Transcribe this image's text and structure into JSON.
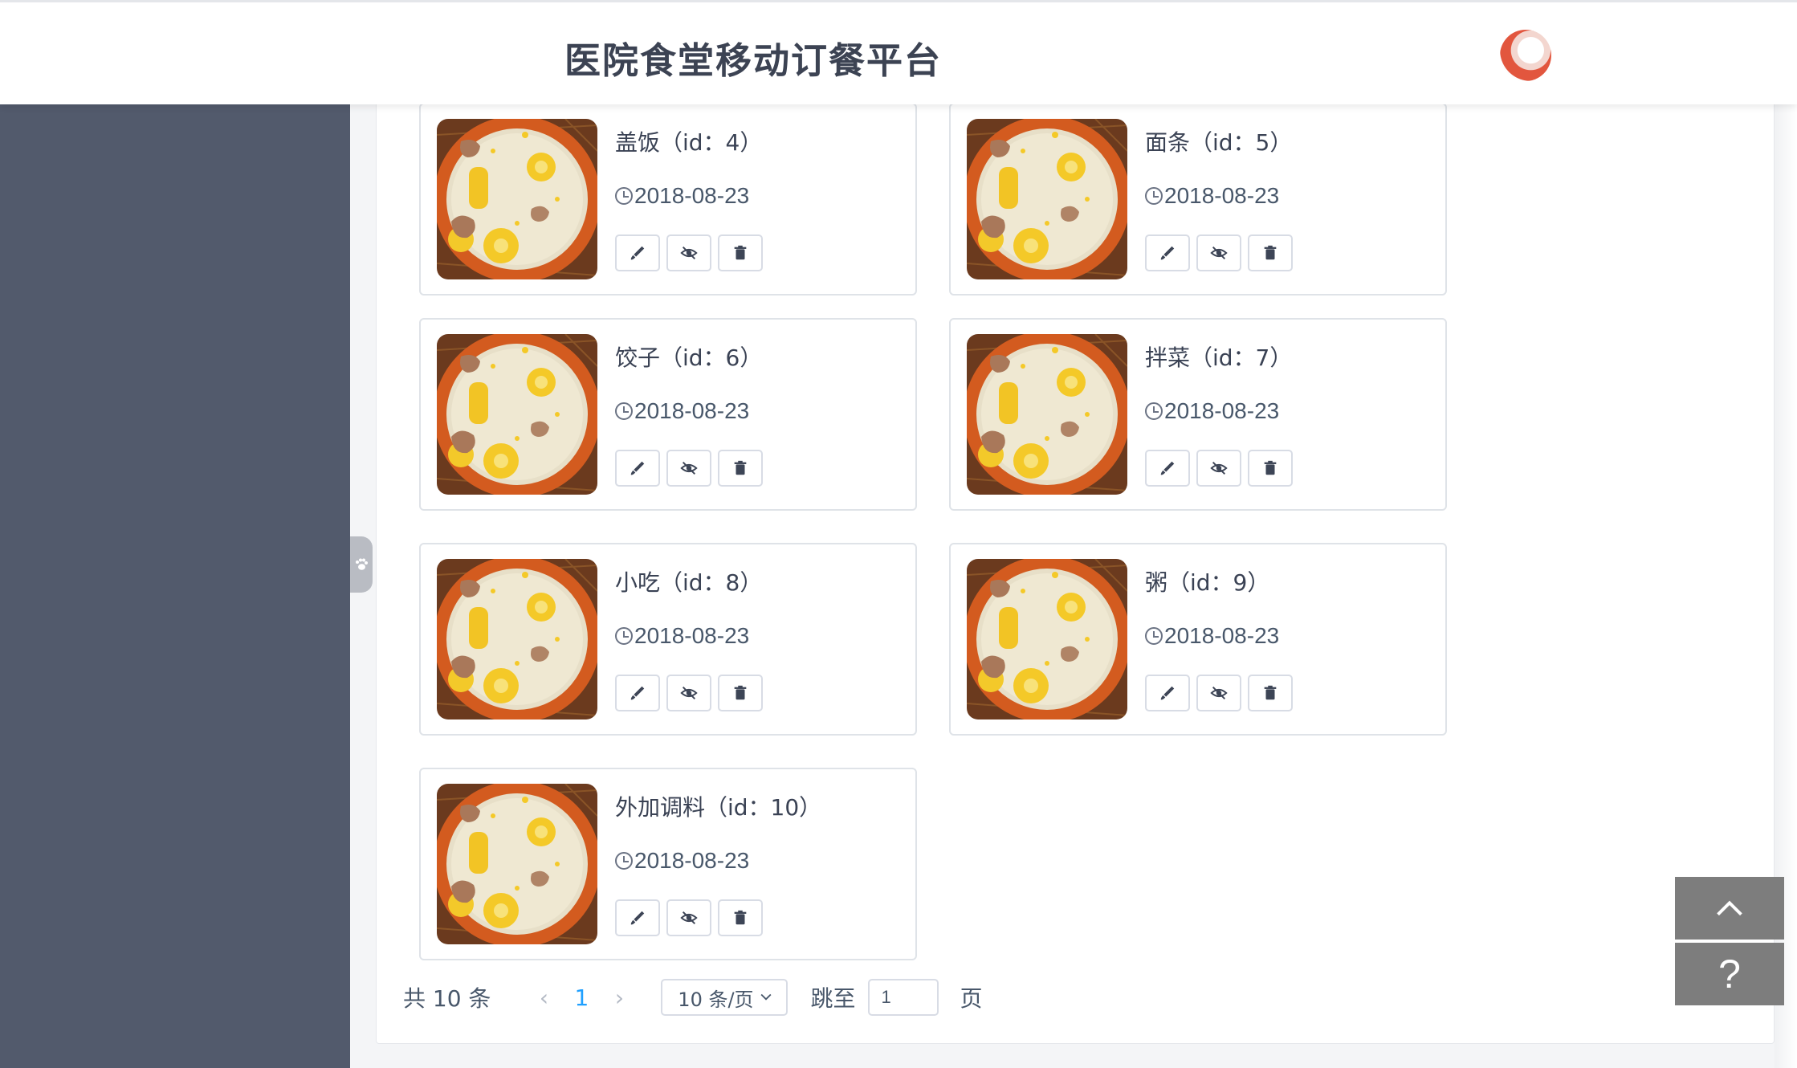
{
  "header": {
    "title": "医院食堂移动订餐平台"
  },
  "colors": {
    "sidebar": "#525a6c",
    "accent": "#20a0ff",
    "float_button": "#7d7d7d"
  },
  "cards": [
    {
      "name": "盖饭（id：4）",
      "date": "2018-08-23"
    },
    {
      "name": "面条（id：5）",
      "date": "2018-08-23"
    },
    {
      "name": "饺子（id：6）",
      "date": "2018-08-23"
    },
    {
      "name": "拌菜（id：7）",
      "date": "2018-08-23"
    },
    {
      "name": "小吃（id：8）",
      "date": "2018-08-23"
    },
    {
      "name": "粥（id：9）",
      "date": "2018-08-23"
    },
    {
      "name": "外加调料（id：10）",
      "date": "2018-08-23"
    }
  ],
  "card_actions": [
    "edit-icon",
    "hide-icon",
    "delete-icon"
  ],
  "pagination": {
    "total_text": "共 10 条",
    "current_page": "1",
    "page_size": "10 条/页",
    "jump_label": "跳至",
    "jump_value": "1",
    "jump_suffix": "页"
  },
  "float_buttons": {
    "top_icon": "chevron-up-icon",
    "help_label": "?"
  }
}
